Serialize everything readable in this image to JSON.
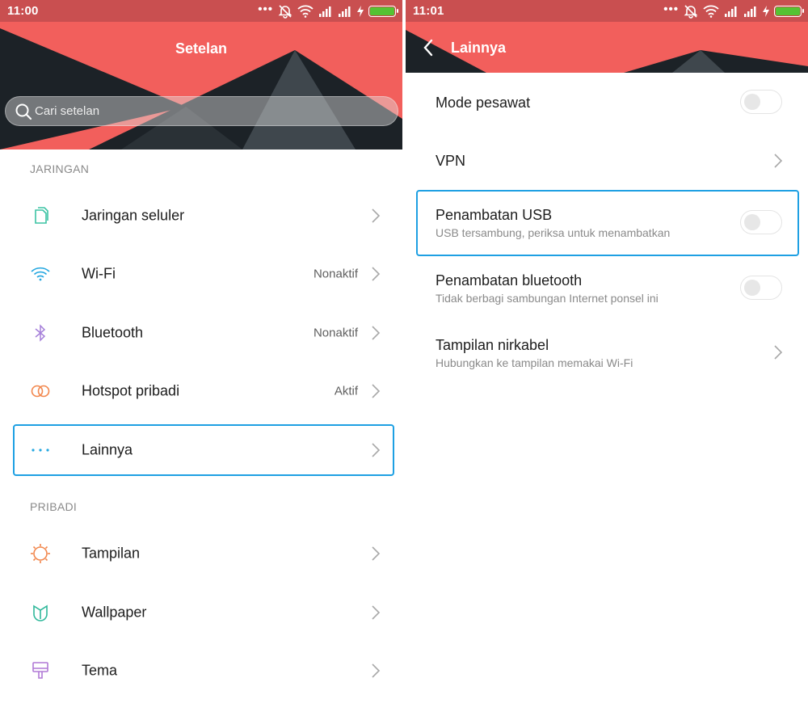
{
  "left": {
    "status": {
      "time": "11:00"
    },
    "header": {
      "title": "Setelan"
    },
    "search": {
      "placeholder": "Cari setelan"
    },
    "sections": [
      {
        "label": "JARINGAN",
        "items": [
          {
            "icon": "sim-card-icon",
            "label": "Jaringan seluler",
            "value": ""
          },
          {
            "icon": "wifi-icon",
            "label": "Wi-Fi",
            "value": "Nonaktif"
          },
          {
            "icon": "bluetooth-icon",
            "label": "Bluetooth",
            "value": "Nonaktif"
          },
          {
            "icon": "hotspot-icon",
            "label": "Hotspot pribadi",
            "value": "Aktif"
          },
          {
            "icon": "more-dots-icon",
            "label": "Lainnya",
            "value": "",
            "highlighted": true
          }
        ]
      },
      {
        "label": "PRIBADI",
        "items": [
          {
            "icon": "display-icon",
            "label": "Tampilan",
            "value": ""
          },
          {
            "icon": "wallpaper-icon",
            "label": "Wallpaper",
            "value": ""
          },
          {
            "icon": "theme-brush-icon",
            "label": "Tema",
            "value": ""
          }
        ]
      }
    ]
  },
  "right": {
    "status": {
      "time": "11:01"
    },
    "header": {
      "title": "Lainnya"
    },
    "items": [
      {
        "title": "Mode pesawat",
        "subtitle": "",
        "control": "toggle",
        "on": false
      },
      {
        "title": "VPN",
        "subtitle": "",
        "control": "chevron"
      },
      {
        "title": "Penambatan USB",
        "subtitle": "USB tersambung, periksa untuk menambatkan",
        "control": "toggle",
        "on": false,
        "highlighted": true
      },
      {
        "title": "Penambatan bluetooth",
        "subtitle": "Tidak berbagi sambungan Internet ponsel ini",
        "control": "toggle",
        "on": false
      },
      {
        "title": "Tampilan nirkabel",
        "subtitle": "Hubungkan ke tampilan memakai Wi-Fi",
        "control": "chevron"
      }
    ]
  },
  "colors": {
    "header_red": "#f25f5c",
    "status_red": "#c94f50",
    "highlight_blue": "#1ea0e3",
    "battery_green": "#55c233"
  }
}
